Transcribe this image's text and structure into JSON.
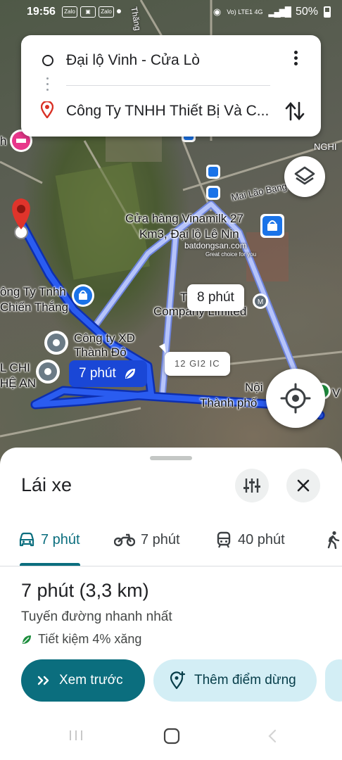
{
  "status_bar": {
    "time": "19:56",
    "notif_icons": [
      "Zalo",
      "",
      "Zalo"
    ],
    "battery": "50%",
    "network": "Vo) LTE1 4G"
  },
  "search": {
    "origin": "Đại lộ Vinh - Cửa Lò",
    "destination": "Công Ty TNHH Thiết Bị Và C..."
  },
  "map": {
    "labels": {
      "store_name": "Cửa hàng Vinamilk 27",
      "store_addr": "Km3, Đại lộ Lê Nin",
      "company_left_1": "ông Ty Tnhh",
      "company_left_2": "Chiến Thắng",
      "company_xd_1": "Công ty XD",
      "company_xd_2": "Thành Đô",
      "company_ltd": "Company Limited",
      "company_t": "T",
      "l_chi": "L CHI",
      "he_an": "HỆ AN",
      "mai_lao_bang": "Mai Lão Bạng",
      "nghi": "NGHI",
      "noi": "Nội",
      "thanh_pho": "Thành phố",
      "v": "V",
      "h": "h",
      "thang": "Thăng",
      "watermark_1": "batdongsan.com",
      "watermark_2": "Great choice for you"
    },
    "bubble_main": "7 phút",
    "bubble_alt": "8 phút",
    "bubble_alt2": "12 GI2 IC"
  },
  "sheet": {
    "title": "Lái xe",
    "modes": [
      {
        "label": "7 phút",
        "icon": "car-icon"
      },
      {
        "label": "7 phút",
        "icon": "motorbike-icon"
      },
      {
        "label": "40 phút",
        "icon": "transit-icon"
      }
    ],
    "summary_time": "7 phút (3,3 km)",
    "summary_desc": "Tuyến đường nhanh nhất",
    "summary_eco": "Tiết kiệm 4% xăng",
    "preview_label": "Xem trước",
    "add_stop_label": "Thêm điểm dừng"
  },
  "colors": {
    "accent": "#0b6e7e",
    "route_main": "#1a47d6",
    "route_alt": "#a9b9f5",
    "pin": "#e0342b"
  }
}
